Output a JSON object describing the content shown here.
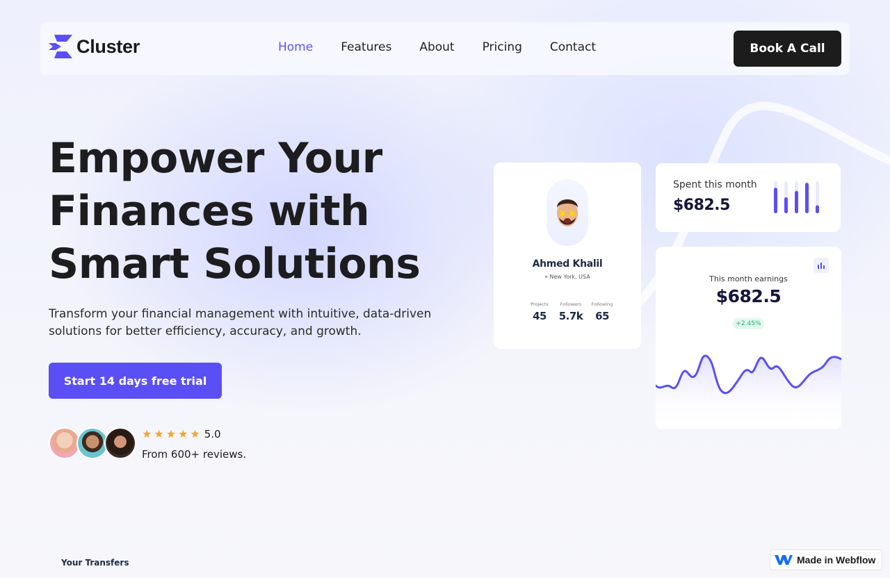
{
  "brand": {
    "name": "Cluster",
    "accent": "#5a4ff5",
    "dark": "#1c1c1c"
  },
  "nav": {
    "links": [
      {
        "label": "Home",
        "active": true
      },
      {
        "label": "Features",
        "active": false
      },
      {
        "label": "About",
        "active": false
      },
      {
        "label": "Pricing",
        "active": false
      },
      {
        "label": "Contact",
        "active": false
      }
    ],
    "cta_label": "Book A Call"
  },
  "hero": {
    "title_lines": [
      "Empower Your",
      "Finances with",
      "Smart Solutions"
    ],
    "subtitle_lines": [
      "Transform your financial management with intuitive, data-driven",
      "solutions for better efficiency, accuracy, and growth."
    ],
    "trial_button": "Start 14 days free trial",
    "rating": "5.0",
    "star_count": 5,
    "review_text": "From 600+ reviews."
  },
  "profile_card": {
    "name": "Ahmed Khalil",
    "location": "New York, USA",
    "stats": [
      {
        "label": "Projects",
        "value": "45"
      },
      {
        "label": "Followers",
        "value": "5.7k"
      },
      {
        "label": "Following",
        "value": "65"
      }
    ]
  },
  "spent_card": {
    "label": "Spent this month",
    "value": "$682.5",
    "bar_levels": [
      0.8,
      0.5,
      0.7,
      0.95,
      0.25
    ]
  },
  "earnings_card": {
    "label": "This month earnings",
    "value": "$682.5",
    "change": "+2.45%"
  },
  "section_label": "Your Transfers",
  "webflow_badge": "Made in Webflow"
}
